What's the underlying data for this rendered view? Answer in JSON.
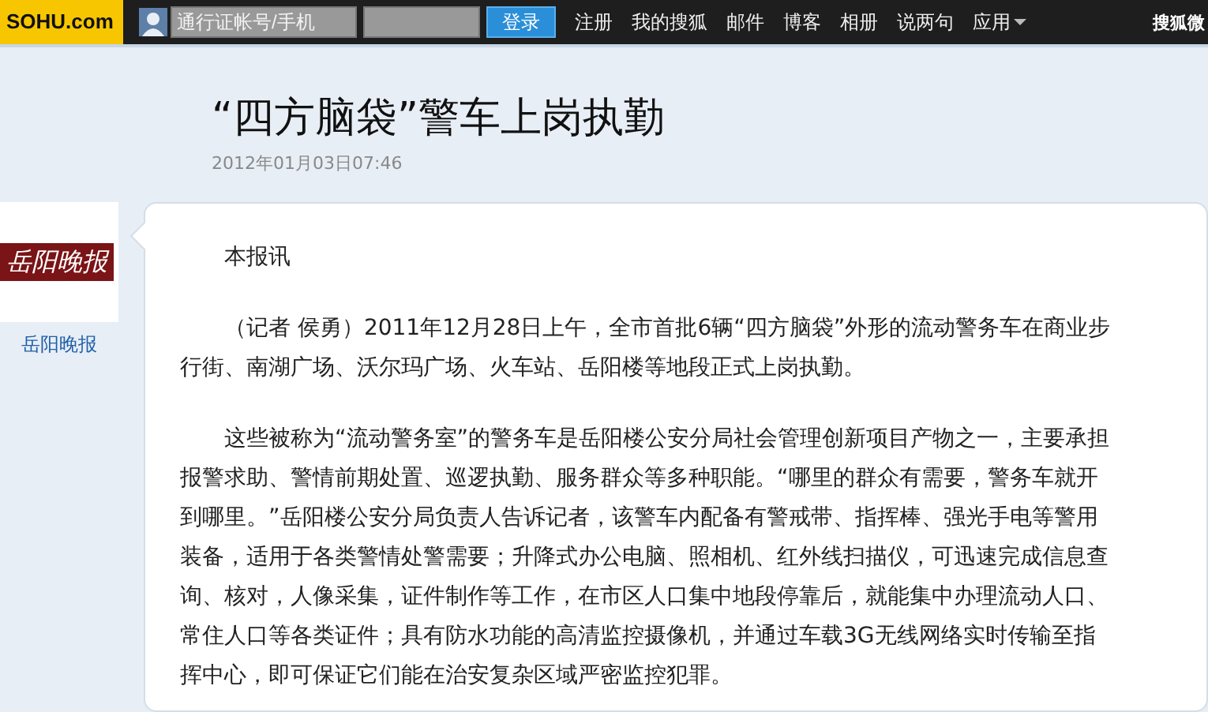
{
  "top_bar": {
    "logo": "SOHU.com",
    "account_field": {
      "placeholder": "通行证帐号/手机"
    },
    "login_button": "登录",
    "links": [
      {
        "label": "注册",
        "kind": "link"
      },
      {
        "label": "我的搜狐",
        "kind": "link"
      },
      {
        "label": "邮件",
        "kind": "link"
      },
      {
        "label": "博客",
        "kind": "link"
      },
      {
        "label": "相册",
        "kind": "link"
      },
      {
        "label": "说两句",
        "kind": "link"
      },
      {
        "label": "应用",
        "kind": "menu"
      }
    ],
    "right_text": "搜狐微"
  },
  "article": {
    "title": "“四方脑袋”警车上岗执勤",
    "time": "2012年01月03日07:46",
    "source": {
      "logo_text": "岳阳晚报",
      "name": "岳阳晚报"
    },
    "paragraphs": [
      "本报讯",
      "（记者  侯勇）2011年12月28日上午，全市首批6辆“四方脑袋”外形的流动警务车在商业步行街、南湖广场、沃尔玛广场、火车站、岳阳楼等地段正式上岗执勤。",
      "这些被称为“流动警务室”的警务车是岳阳楼公安分局社会管理创新项目产物之一，主要承担报警求助、警情前期处置、巡逻执勤、服务群众等多种职能。“哪里的群众有需要，警务车就开到哪里。”岳阳楼公安分局负责人告诉记者，该警车内配备有警戒带、指挥棒、强光手电等警用装备，适用于各类警情处警需要；升降式办公电脑、照相机、红外线扫描仪，可迅速完成信息查询、核对，人像采集，证件制作等工作，在市区人口集中地段停靠后，就能集中办理流动人口、常住人口等各类证件；具有防水功能的高清监控摄像机，并通过车载3G无线网络实时传输至指挥中心，即可保证它们能在治安复杂区域严密监控犯罪。"
    ]
  }
}
